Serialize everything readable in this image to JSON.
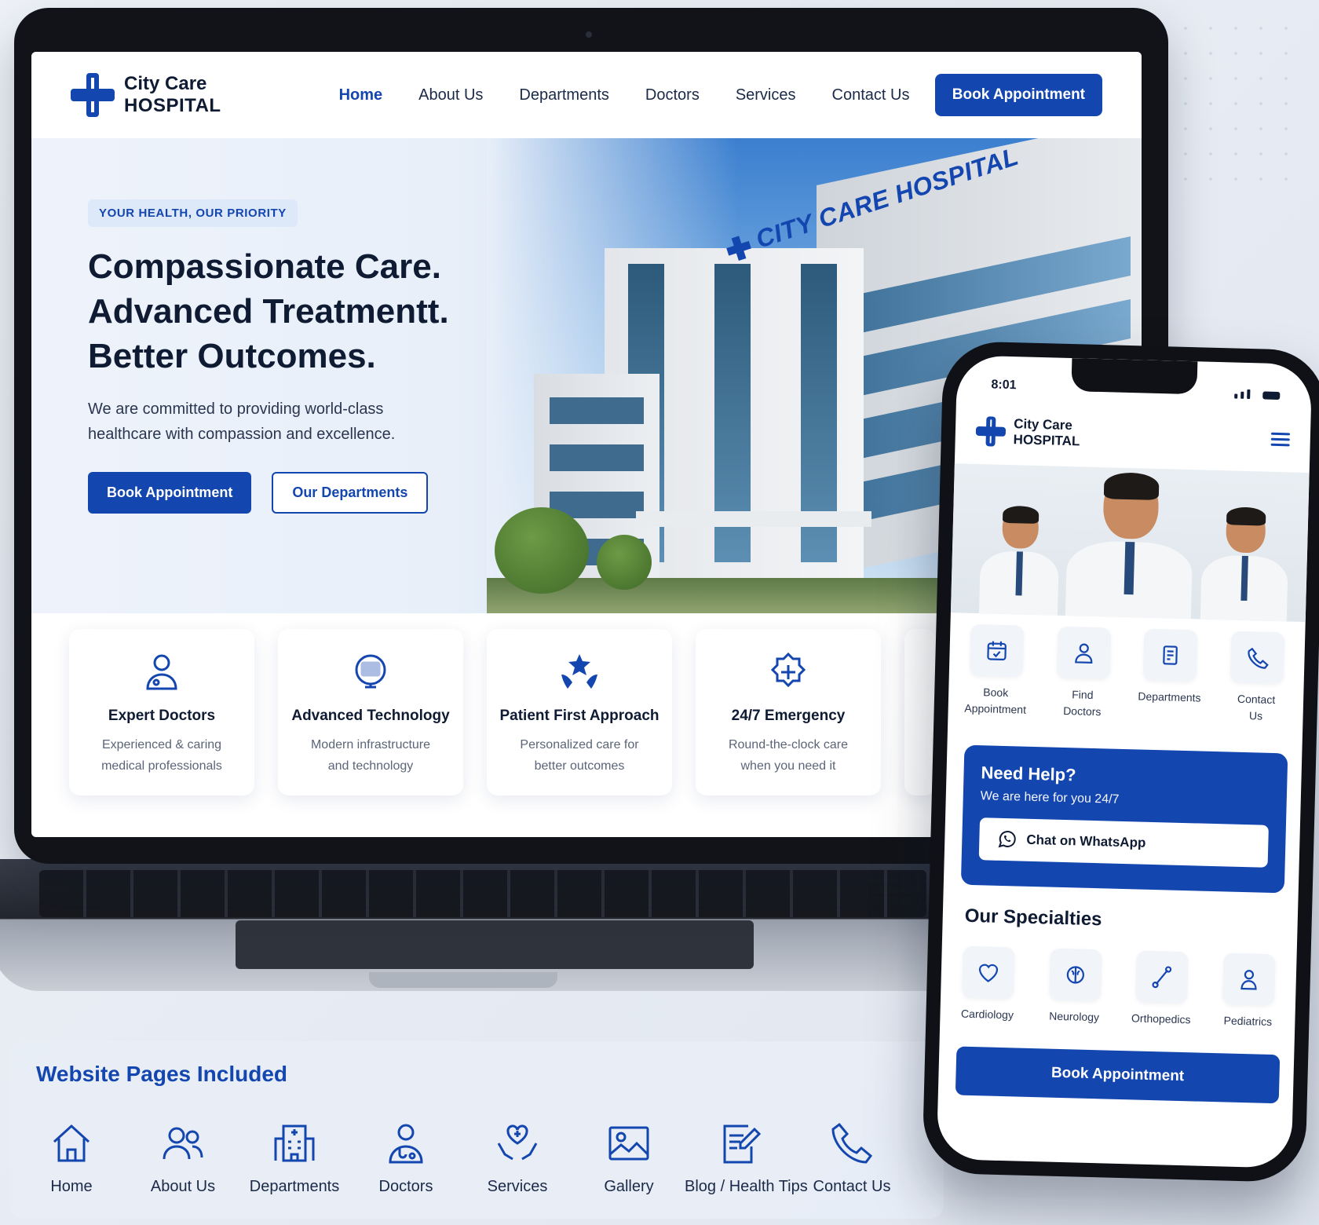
{
  "brand": {
    "line1": "City Care",
    "line2": "HOSPITAL",
    "accent": "#1446b0"
  },
  "nav": {
    "items": [
      {
        "label": "Home",
        "active": true
      },
      {
        "label": "About Us"
      },
      {
        "label": "Departments"
      },
      {
        "label": "Doctors"
      },
      {
        "label": "Services"
      },
      {
        "label": "Contact Us"
      }
    ],
    "cta": "Book Appointment"
  },
  "hero": {
    "eyebrow": "YOUR HEALTH, OUR PRIORITY",
    "headline": [
      "Compassionate Care.",
      "Advanced Treatmentt.",
      "Better Outcomes."
    ],
    "subtext": "We are committed to providing world-class healthcare with compassion and excellence.",
    "primary_btn": "Book Appointment",
    "secondary_btn": "Our Departments",
    "building_sign": "CITY CARE HOSPITAL"
  },
  "features": [
    {
      "icon": "doctor-icon",
      "title": "Expert Doctors",
      "desc": [
        "Experienced & caring",
        "medical professionals"
      ]
    },
    {
      "icon": "monitor-icon",
      "title": "Advanced Technology",
      "desc": [
        "Modern infrastructure",
        "and technology"
      ]
    },
    {
      "icon": "stars-hands-icon",
      "title": "Patient First Approach",
      "desc": [
        "Personalized care for",
        "better outcomes"
      ]
    },
    {
      "icon": "emergency-icon",
      "title": "24/7 Emergency",
      "desc": [
        "Round-the-clock care",
        "when you need it"
      ]
    }
  ],
  "phone": {
    "time": "8:01",
    "brand": {
      "line1": "City Care",
      "line2": "HOSPITAL"
    },
    "quick_actions": [
      {
        "icon": "calendar-icon",
        "label": [
          "Book",
          "Appointment"
        ]
      },
      {
        "icon": "doctor-icon",
        "label": [
          "Find",
          "Doctors"
        ]
      },
      {
        "icon": "building-icon",
        "label": [
          "Departments"
        ]
      },
      {
        "icon": "phone-icon",
        "label": [
          "Contact",
          "Us"
        ]
      }
    ],
    "help": {
      "title": "Need Help?",
      "subtitle": "We are here for you 24/7",
      "button": "Chat on WhatsApp"
    },
    "specialties_title": "Our Specialties",
    "specialties": [
      {
        "icon": "heart-icon",
        "label": "Cardiology"
      },
      {
        "icon": "brain-icon",
        "label": "Neurology"
      },
      {
        "icon": "bone-icon",
        "label": "Orthopedics"
      },
      {
        "icon": "child-icon",
        "label": "Pediatrics"
      }
    ],
    "cta": "Book Appointment"
  },
  "pages_panel": {
    "title": "Website Pages Included",
    "pages": [
      {
        "icon": "home-icon",
        "label": "Home"
      },
      {
        "icon": "users-icon",
        "label": "About Us"
      },
      {
        "icon": "building-icon",
        "label": "Departments"
      },
      {
        "icon": "doctor-icon",
        "label": "Doctors"
      },
      {
        "icon": "care-hands-icon",
        "label": "Services"
      },
      {
        "icon": "image-icon",
        "label": "Gallery"
      },
      {
        "icon": "edit-icon",
        "label": "Blog / Health Tips"
      },
      {
        "icon": "phone-icon",
        "label": "Contact Us"
      }
    ]
  }
}
